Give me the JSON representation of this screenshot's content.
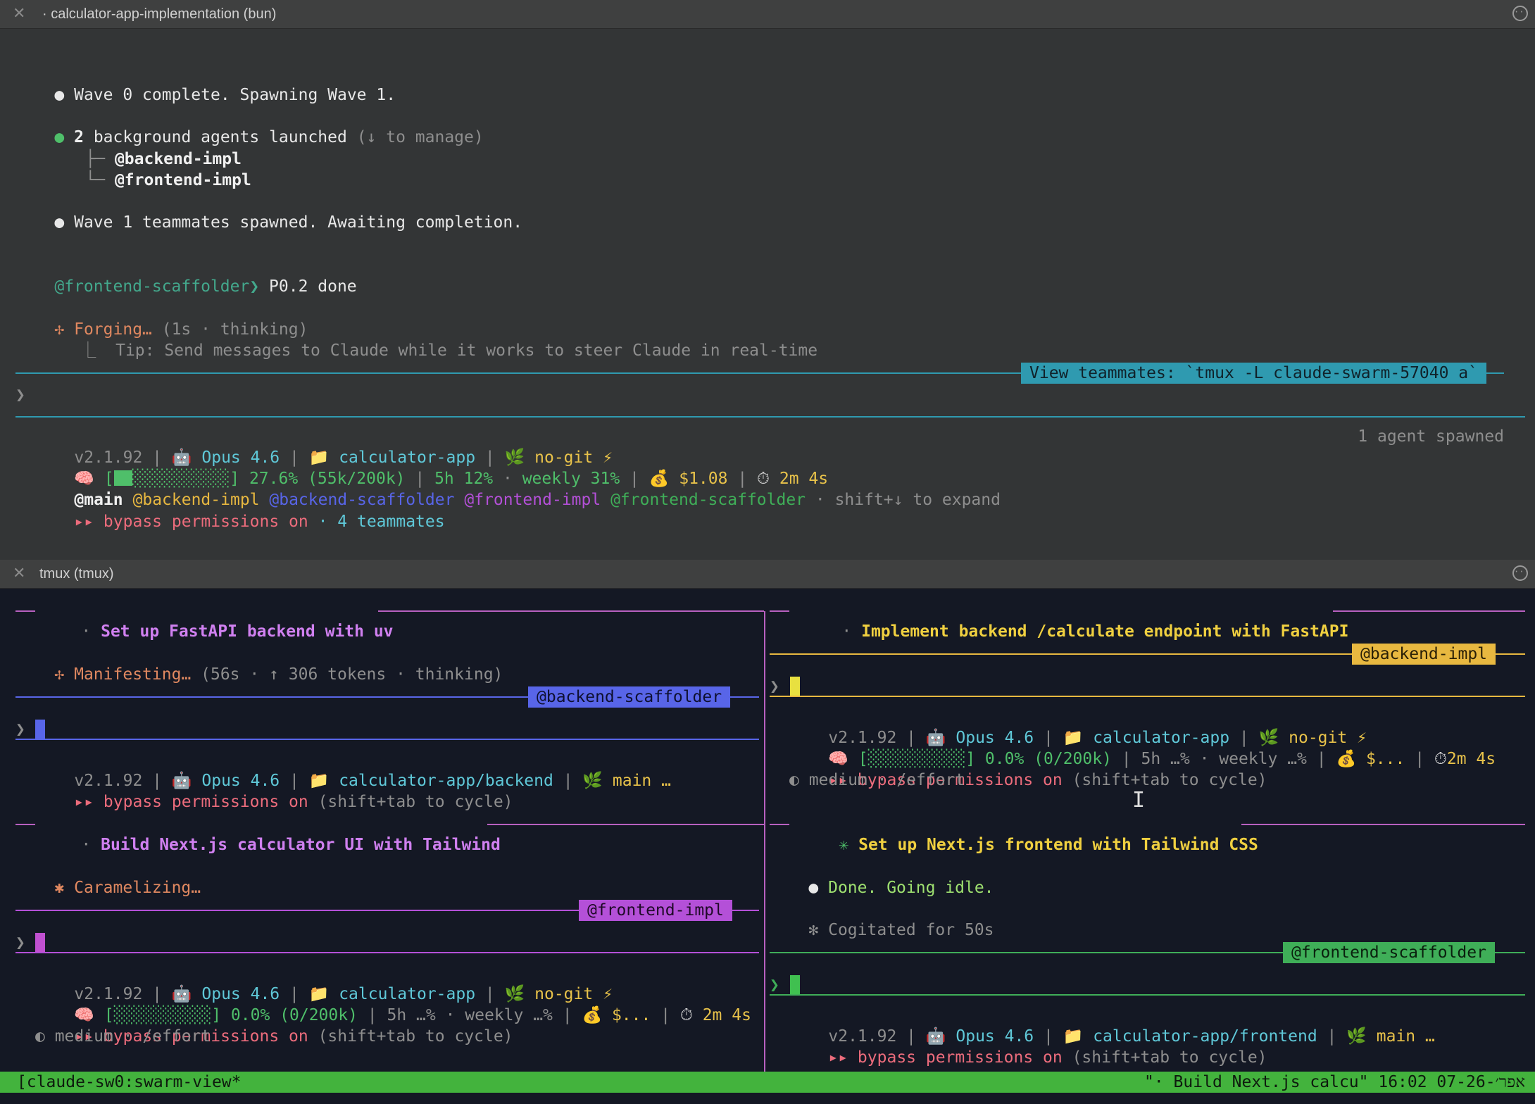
{
  "window1": {
    "title": "· calculator-app-implementation (bun)",
    "lines": {
      "wave0": "Wave 0 complete. Spawning Wave 1.",
      "agents_count": "2",
      "agents_text": " background agents launched",
      "agents_hint": " (↓ to manage)",
      "agent1": "@backend-impl",
      "agent2": "@frontend-impl",
      "wave1": "Wave 1 teammates spawned. Awaiting completion.",
      "msg_from": "@frontend-scaffolder❯",
      "msg_text": " P0.2 done",
      "forging": "Forging…",
      "forging_meta": " (1s · thinking)",
      "tip": "Tip: Send messages to Claude while it works to steer Claude in real-time",
      "view_teammates": "View teammates: `tmux -L claude-swarm-57040 a`",
      "prompt": "❯"
    },
    "status": {
      "version": "v2.1.92",
      "model": "Opus 4.6",
      "project": "calculator-app",
      "git": "no-git",
      "spawned": "1 agent spawned",
      "usage": "27.6% (55k/200k)",
      "session": "5h 12%",
      "weekly": "weekly 31%",
      "cost": "$1.08",
      "time": "2m 4s",
      "main": "@main",
      "mentions": [
        "@backend-impl",
        "@backend-scaffolder",
        "@frontend-impl",
        "@frontend-scaffolder"
      ],
      "expand_hint": " · shift+↓ to expand",
      "bypass": "▸▸ bypass permissions on",
      "teammates": " · 4 teammates"
    }
  },
  "window2": {
    "title": "tmux (tmux)",
    "panes": {
      "tl": {
        "heading": "Set up FastAPI backend with uv",
        "activity": "Manifesting…",
        "activity_meta": " (56s · ↑ 306 tokens · thinking)",
        "tag": "@backend-scaffolder",
        "version": "v2.1.92",
        "model": "Opus 4.6",
        "project": "calculator-app/backend",
        "git": "main …",
        "bypass": "▸▸ bypass permissions on",
        "bypass_hint": " (shift+tab to cycle)"
      },
      "tr": {
        "heading": "Implement backend /calculate endpoint with FastAPI",
        "tag": "@backend-impl",
        "version": "v2.1.92",
        "model": "Opus 4.6",
        "project": "calculator-app",
        "git": "no-git",
        "usage": "0.0% (0/200k)",
        "session": "5h …%",
        "weekly": "weekly …%",
        "cost": "$...",
        "time": "2m 4s",
        "bypass": "▸▸ bypass permissions on",
        "bypass_hint": " (shift+tab to cycle)",
        "effort": "◐ medium · /effort"
      },
      "bl": {
        "heading": "Build Next.js calculator UI with Tailwind",
        "activity": "Caramelizing…",
        "tag": "@frontend-impl",
        "version": "v2.1.92",
        "model": "Opus 4.6",
        "project": "calculator-app",
        "git": "no-git",
        "usage": "0.0% (0/200k)",
        "session": "5h …%",
        "weekly": "weekly …%",
        "cost": "$...",
        "time": "2m 4s",
        "bypass": "▸▸ bypass permissions on",
        "bypass_hint": " (shift+tab to cycle)",
        "effort": "◐ medium · /effort"
      },
      "br": {
        "heading": "Set up Next.js frontend with Tailwind CSS",
        "done": "Done. Going idle.",
        "cogitated": "Cogitated for 50s",
        "tag": "@frontend-scaffolder",
        "version": "v2.1.92",
        "model": "Opus 4.6",
        "project": "calculator-app/frontend",
        "git": "main …",
        "bypass": "▸▸ bypass permissions on",
        "bypass_hint": " (shift+tab to cycle)"
      }
    },
    "statusbar": {
      "left": "[claude-sw0:swarm-view*",
      "right": "\"· Build Next.js calcu\" 16:02 07-אפר׳-26"
    }
  },
  "colors": {
    "backend_scaffolder": "#5865e8",
    "backend_impl": "#e8b840",
    "frontend_impl": "#b450d8",
    "frontend_scaffolder": "#3fae58",
    "view_teammates_bg": "#2f9ab0",
    "statusbar": "#43b33d"
  }
}
